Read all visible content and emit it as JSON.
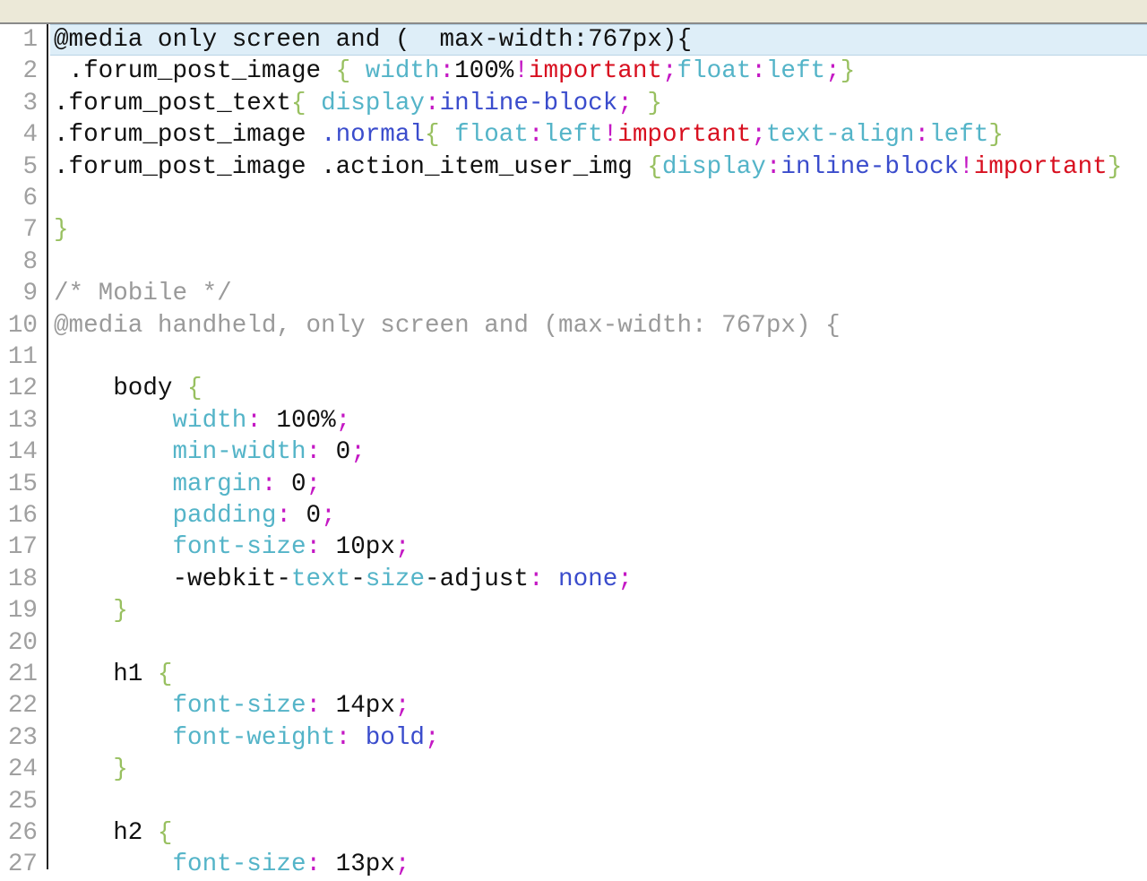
{
  "colors": {
    "property": "#54b4c8",
    "value": "#3a4ccc",
    "punct": "#c418c4",
    "important": "#d81020",
    "brace": "#98c060",
    "comment": "#9a9a9a"
  },
  "current_line": 1,
  "lines": [
    {
      "n": "1",
      "tokens": [
        {
          "t": "@media only screen and (  max-width:767px){",
          "c": "d"
        }
      ]
    },
    {
      "n": "2",
      "tokens": [
        {
          "t": " .forum_post_image ",
          "c": "d"
        },
        {
          "t": "{",
          "c": "b"
        },
        {
          "t": " width",
          "c": "p"
        },
        {
          "t": ":",
          "c": "c"
        },
        {
          "t": "100%",
          "c": "d"
        },
        {
          "t": "!",
          "c": "c"
        },
        {
          "t": "important",
          "c": "i"
        },
        {
          "t": ";",
          "c": "c"
        },
        {
          "t": "float",
          "c": "p"
        },
        {
          "t": ":",
          "c": "c"
        },
        {
          "t": "left",
          "c": "p"
        },
        {
          "t": ";",
          "c": "c"
        },
        {
          "t": "}",
          "c": "b"
        }
      ]
    },
    {
      "n": "3",
      "tokens": [
        {
          "t": ".forum_post_text",
          "c": "d"
        },
        {
          "t": "{",
          "c": "b"
        },
        {
          "t": " display",
          "c": "p"
        },
        {
          "t": ":",
          "c": "c"
        },
        {
          "t": "inline-block",
          "c": "v"
        },
        {
          "t": ";",
          "c": "c"
        },
        {
          "t": " }",
          "c": "b"
        }
      ]
    },
    {
      "n": "4",
      "tokens": [
        {
          "t": ".forum_post_image ",
          "c": "d"
        },
        {
          "t": ".normal",
          "c": "v"
        },
        {
          "t": "{",
          "c": "b"
        },
        {
          "t": " float",
          "c": "p"
        },
        {
          "t": ":",
          "c": "c"
        },
        {
          "t": "left",
          "c": "p"
        },
        {
          "t": "!",
          "c": "c"
        },
        {
          "t": "important",
          "c": "i"
        },
        {
          "t": ";",
          "c": "c"
        },
        {
          "t": "text-align",
          "c": "p"
        },
        {
          "t": ":",
          "c": "c"
        },
        {
          "t": "left",
          "c": "p"
        },
        {
          "t": "}",
          "c": "b"
        }
      ]
    },
    {
      "n": "5",
      "tokens": [
        {
          "t": ".forum_post_image .action_item_user_img ",
          "c": "d"
        },
        {
          "t": "{",
          "c": "b"
        },
        {
          "t": "display",
          "c": "p"
        },
        {
          "t": ":",
          "c": "c"
        },
        {
          "t": "inline-block",
          "c": "v"
        },
        {
          "t": "!",
          "c": "c"
        },
        {
          "t": "important",
          "c": "i"
        },
        {
          "t": "}",
          "c": "b"
        }
      ]
    },
    {
      "n": "6",
      "tokens": []
    },
    {
      "n": "7",
      "tokens": [
        {
          "t": "}",
          "c": "b"
        }
      ]
    },
    {
      "n": "8",
      "tokens": []
    },
    {
      "n": "9",
      "tokens": [
        {
          "t": "/* Mobile */",
          "c": "m"
        }
      ]
    },
    {
      "n": "10",
      "tokens": [
        {
          "t": "@media handheld, only screen and (max-width: 767px) {",
          "c": "m"
        }
      ]
    },
    {
      "n": "11",
      "tokens": []
    },
    {
      "n": "12",
      "tokens": [
        {
          "t": "    body ",
          "c": "d"
        },
        {
          "t": "{",
          "c": "b"
        }
      ]
    },
    {
      "n": "13",
      "tokens": [
        {
          "t": "        width",
          "c": "p"
        },
        {
          "t": ":",
          "c": "c"
        },
        {
          "t": " 100%",
          "c": "d"
        },
        {
          "t": ";",
          "c": "c"
        }
      ]
    },
    {
      "n": "14",
      "tokens": [
        {
          "t": "        min-width",
          "c": "p"
        },
        {
          "t": ":",
          "c": "c"
        },
        {
          "t": " 0",
          "c": "d"
        },
        {
          "t": ";",
          "c": "c"
        }
      ]
    },
    {
      "n": "15",
      "tokens": [
        {
          "t": "        margin",
          "c": "p"
        },
        {
          "t": ":",
          "c": "c"
        },
        {
          "t": " 0",
          "c": "d"
        },
        {
          "t": ";",
          "c": "c"
        }
      ]
    },
    {
      "n": "16",
      "tokens": [
        {
          "t": "        padding",
          "c": "p"
        },
        {
          "t": ":",
          "c": "c"
        },
        {
          "t": " 0",
          "c": "d"
        },
        {
          "t": ";",
          "c": "c"
        }
      ]
    },
    {
      "n": "17",
      "tokens": [
        {
          "t": "        font-size",
          "c": "p"
        },
        {
          "t": ":",
          "c": "c"
        },
        {
          "t": " 10px",
          "c": "d"
        },
        {
          "t": ";",
          "c": "c"
        }
      ]
    },
    {
      "n": "18",
      "tokens": [
        {
          "t": "        -webkit-",
          "c": "d"
        },
        {
          "t": "text",
          "c": "p"
        },
        {
          "t": "-",
          "c": "d"
        },
        {
          "t": "size",
          "c": "p"
        },
        {
          "t": "-adjust",
          "c": "d"
        },
        {
          "t": ":",
          "c": "c"
        },
        {
          "t": " none",
          "c": "v"
        },
        {
          "t": ";",
          "c": "c"
        }
      ]
    },
    {
      "n": "19",
      "tokens": [
        {
          "t": "    }",
          "c": "b"
        }
      ]
    },
    {
      "n": "20",
      "tokens": []
    },
    {
      "n": "21",
      "tokens": [
        {
          "t": "    h1 ",
          "c": "d"
        },
        {
          "t": "{",
          "c": "b"
        }
      ]
    },
    {
      "n": "22",
      "tokens": [
        {
          "t": "        font-size",
          "c": "p"
        },
        {
          "t": ":",
          "c": "c"
        },
        {
          "t": " 14px",
          "c": "d"
        },
        {
          "t": ";",
          "c": "c"
        }
      ]
    },
    {
      "n": "23",
      "tokens": [
        {
          "t": "        font-weight",
          "c": "p"
        },
        {
          "t": ":",
          "c": "c"
        },
        {
          "t": " bold",
          "c": "v"
        },
        {
          "t": ";",
          "c": "c"
        }
      ]
    },
    {
      "n": "24",
      "tokens": [
        {
          "t": "    }",
          "c": "b"
        }
      ]
    },
    {
      "n": "25",
      "tokens": []
    },
    {
      "n": "26",
      "tokens": [
        {
          "t": "    h2 ",
          "c": "d"
        },
        {
          "t": "{",
          "c": "b"
        }
      ]
    },
    {
      "n": "27",
      "tokens": [
        {
          "t": "        font-size",
          "c": "p"
        },
        {
          "t": ":",
          "c": "c"
        },
        {
          "t": " 13px",
          "c": "d"
        },
        {
          "t": ";",
          "c": "c"
        }
      ]
    }
  ]
}
